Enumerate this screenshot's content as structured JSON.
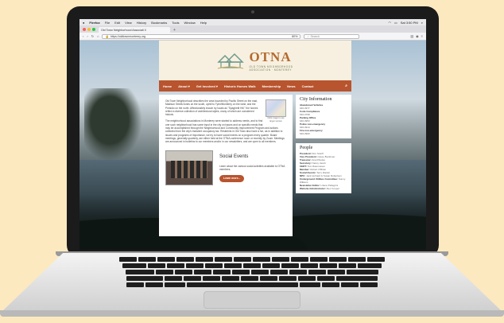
{
  "mac_menubar": {
    "items": [
      "Firefox",
      "File",
      "Edit",
      "View",
      "History",
      "Bookmarks",
      "Tools",
      "Window",
      "Help"
    ],
    "clock": "Sat 3:50 PM"
  },
  "browser": {
    "tab_title": "Old Town Neighborhood Associati X",
    "url": "https://oldtownmonterey.org",
    "search_placeholder": "Search",
    "zoom": "80%"
  },
  "site": {
    "brand": "OTNA",
    "tagline_1": "OLD TOWN NEIGHBORHOOD",
    "tagline_2": "ASSOCIATION · MONTEREY",
    "nav": [
      "Home",
      "About ▾",
      "Get Involved ▾",
      "Historic Homes Walk",
      "Membership",
      "News",
      "Contact"
    ],
    "intro_p1": "Old Town Neighborhood describes the area bounded by Pacific Street on the east, Madison Street/Jones on the south, uphill to Tyler/Monterey on the west, and the Presidio on the north. Affectionately known by locals as \"Spaghetti Hill,\" the homes reflect a diverse collection of architectural styles, many of which are considered historic.",
    "intro_p2": "The neighborhood associations in Monterey were started to address needs, and to find one such neighborhood has some input in the city on issues and on specific needs that may be accomplished through the Neighborhood and Community Improvement Program and actions collected from the city's transient occupancy tax. Residents in Old Town also have a fun, as in addition to issues and programs of importance, we try to have social events on a program every quarter. Board meetings, generally quarterly, are either held at the OTNA conference room or recently by Zoom. Meetings are announced in bulletins to our members and/or in our newsletters, and are open to all members.",
    "map_caption": "Click image to see larger version",
    "events_title": "Social Events",
    "events_desc": "Learn about the various social activities available to OTNA members.",
    "events_button": "Learn more..."
  },
  "city_info": {
    "title": "City Information",
    "rows": [
      {
        "label": "Abandoned Vehicles",
        "value": "646-3977"
      },
      {
        "label": "Code Compliance",
        "value": "646-3798"
      },
      {
        "label": "Parking Office",
        "value": "646-3953"
      },
      {
        "label": "Police non-emergency",
        "value": "646-3914"
      },
      {
        "label": "Fire non-emergency",
        "value": "646-3900"
      }
    ]
  },
  "people": {
    "title": "People",
    "rows": [
      {
        "role": "President:",
        "name": "Ron Scarff"
      },
      {
        "role": "Vice President:",
        "name": "Casey Buckman"
      },
      {
        "role": "Treasurer:",
        "name": "Ana Rhodes"
      },
      {
        "role": "Secretary:",
        "name": "Nancy Jacob"
      },
      {
        "role": "CERT:",
        "name": "Tom Rasmussen"
      },
      {
        "role": "Member:",
        "name": "Robert O'Brian"
      },
      {
        "role": "Social Events:",
        "name": "Terry Rankin"
      },
      {
        "role": "NPC:",
        "name": "Jack Horhard & Susan Robertson"
      },
      {
        "role": "Underground Utilities Committee:",
        "name": "Sunny Wilkens"
      },
      {
        "role": "Newsletter Editor:",
        "name": "Libera Pellegrini"
      },
      {
        "role": "Website Administrator:",
        "name": "Alex Cooper"
      }
    ]
  },
  "colors": {
    "background": "#fde9bf",
    "nav": "#b8542e",
    "brand": "#b46a2f"
  }
}
